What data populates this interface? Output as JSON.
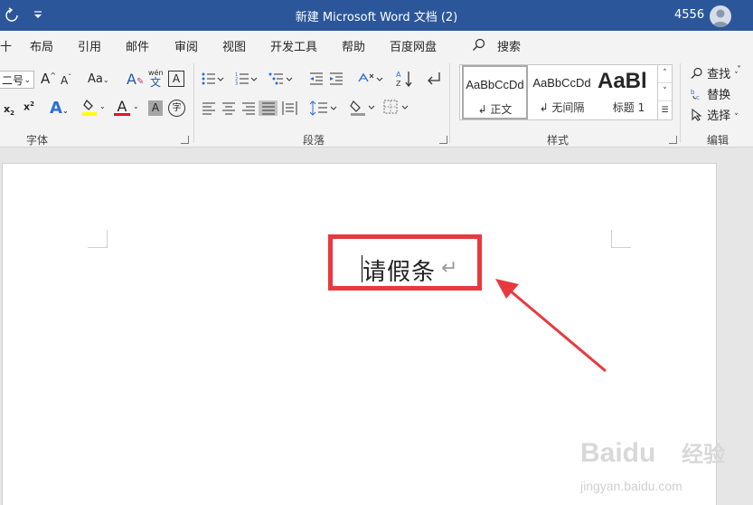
{
  "titlebar": {
    "title": "新建 Microsoft Word 文档 (2)",
    "user": "4556"
  },
  "menu": {
    "tabs": [
      "十",
      "布局",
      "引用",
      "邮件",
      "审阅",
      "视图",
      "开发工具",
      "帮助",
      "百度网盘"
    ],
    "search_label": "搜索"
  },
  "font_group": {
    "label": "字体",
    "font_size": "二号",
    "wen_top": "wén",
    "wen_bottom": "文"
  },
  "paragraph_group": {
    "label": "段落"
  },
  "styles_group": {
    "label": "样式",
    "items": [
      {
        "preview": "AaBbCcDd",
        "name": "↲ 正文"
      },
      {
        "preview": "AaBbCcDd",
        "name": "↲ 无间隔"
      },
      {
        "preview": "AaBl",
        "name": "标题 1"
      }
    ]
  },
  "editing_group": {
    "label": "编辑",
    "find": "查找",
    "replace": "替换",
    "select": "选择"
  },
  "document": {
    "text": "请假条",
    "paragraph_mark": "↵"
  },
  "colors": {
    "titlebar": "#2b579a",
    "highlight_annotation": "#e8393f",
    "font_color": "#e81123",
    "highlight_color": "#ffff00"
  },
  "watermark": {
    "brand": "Baidu",
    "brand_cn": "经验",
    "url": "jingyan.baidu.com"
  }
}
